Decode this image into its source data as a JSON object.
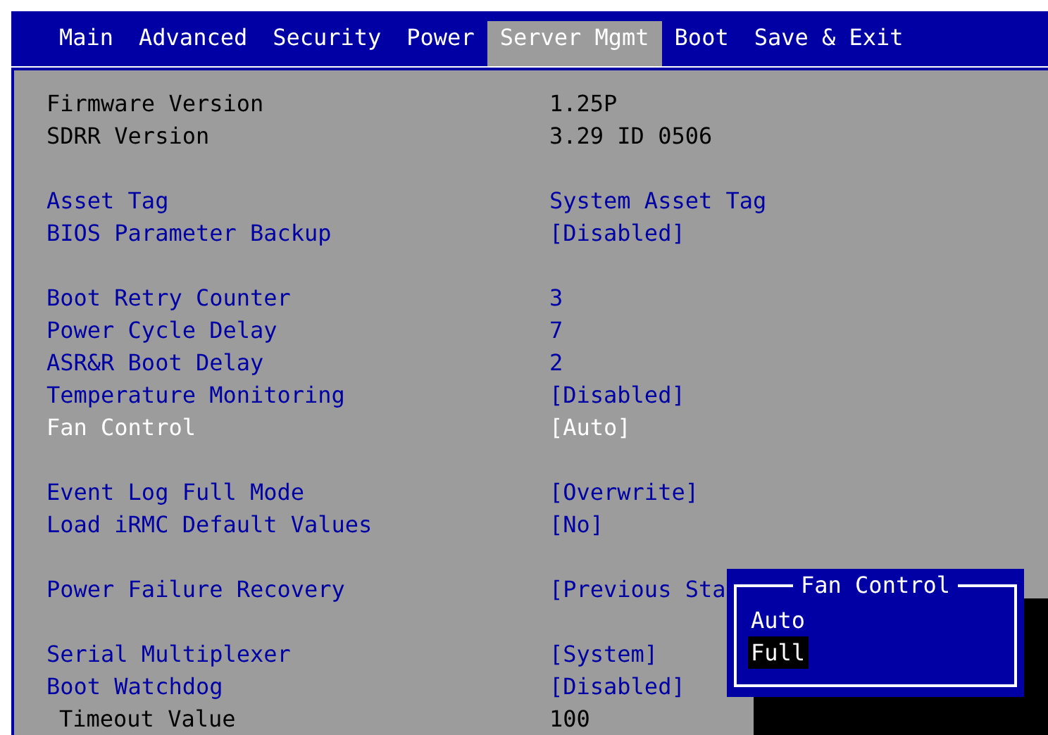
{
  "tabs": [
    {
      "label": "Main",
      "selected": false
    },
    {
      "label": "Advanced",
      "selected": false
    },
    {
      "label": "Security",
      "selected": false
    },
    {
      "label": "Power",
      "selected": false
    },
    {
      "label": "Server Mgmt",
      "selected": true
    },
    {
      "label": "Boot",
      "selected": false
    },
    {
      "label": "Save & Exit",
      "selected": false
    }
  ],
  "groups": [
    {
      "rows": [
        {
          "kind": "info",
          "label": "Firmware Version",
          "value": "1.25P",
          "selected": false
        },
        {
          "kind": "info",
          "label": "SDRR Version",
          "value": "3.29 ID 0506",
          "selected": false
        }
      ]
    },
    {
      "rows": [
        {
          "kind": "option",
          "label": "Asset Tag",
          "value": "System Asset Tag",
          "selected": false
        },
        {
          "kind": "option",
          "label": "BIOS Parameter Backup",
          "value": "[Disabled]",
          "selected": false
        }
      ]
    },
    {
      "rows": [
        {
          "kind": "option",
          "label": "Boot Retry Counter",
          "value": "3",
          "selected": false
        },
        {
          "kind": "option",
          "label": "Power Cycle Delay",
          "value": "7",
          "selected": false
        },
        {
          "kind": "option",
          "label": "ASR&R Boot Delay",
          "value": "2",
          "selected": false
        },
        {
          "kind": "option",
          "label": "Temperature Monitoring",
          "value": "[Disabled]",
          "selected": false
        },
        {
          "kind": "option",
          "label": "Fan Control",
          "value": "[Auto]",
          "selected": true
        }
      ]
    },
    {
      "rows": [
        {
          "kind": "option",
          "label": "Event Log Full Mode",
          "value": "[Overwrite]",
          "selected": false
        },
        {
          "kind": "option",
          "label": "Load iRMC Default Values",
          "value": "[No]",
          "selected": false
        }
      ]
    },
    {
      "rows": [
        {
          "kind": "option",
          "label": "Power Failure Recovery",
          "value": "[Previous Sta",
          "selected": false
        }
      ]
    },
    {
      "rows": [
        {
          "kind": "option",
          "label": "Serial Multiplexer",
          "value": "[System]",
          "selected": false
        },
        {
          "kind": "option",
          "label": "Boot Watchdog",
          "value": "[Disabled]",
          "selected": false
        },
        {
          "kind": "sub",
          "label": "Timeout Value",
          "value": "100",
          "selected": false
        }
      ]
    }
  ],
  "popup": {
    "title": "Fan Control",
    "options": [
      {
        "label": "Auto",
        "selected": false
      },
      {
        "label": "Full",
        "selected": true
      }
    ]
  }
}
